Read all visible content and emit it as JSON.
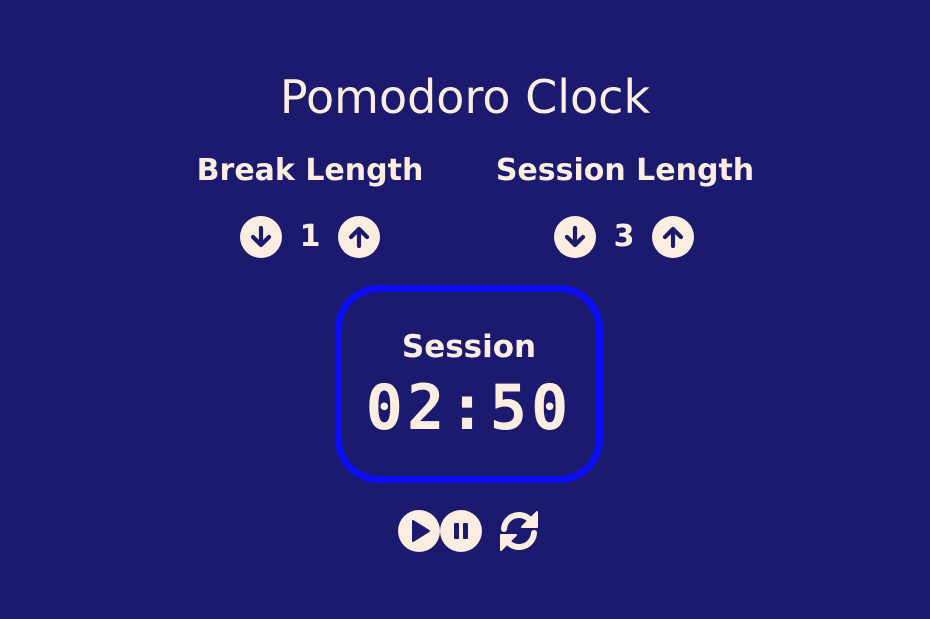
{
  "app": {
    "title": "Pomodoro Clock"
  },
  "break": {
    "label": "Break Length",
    "value": "1",
    "decrement_icon": "arrow-down-circle-icon",
    "increment_icon": "arrow-up-circle-icon"
  },
  "session": {
    "label": "Session Length",
    "value": "3",
    "decrement_icon": "arrow-down-circle-icon",
    "increment_icon": "arrow-up-circle-icon"
  },
  "timer": {
    "label": "Session",
    "time": "02:50"
  },
  "controls": {
    "play_icon": "play-circle-icon",
    "pause_icon": "pause-circle-icon",
    "reset_icon": "refresh-icon"
  },
  "colors": {
    "background": "#1b1a6e",
    "foreground": "#fbeee0",
    "timer_border": "#0a0df5"
  }
}
